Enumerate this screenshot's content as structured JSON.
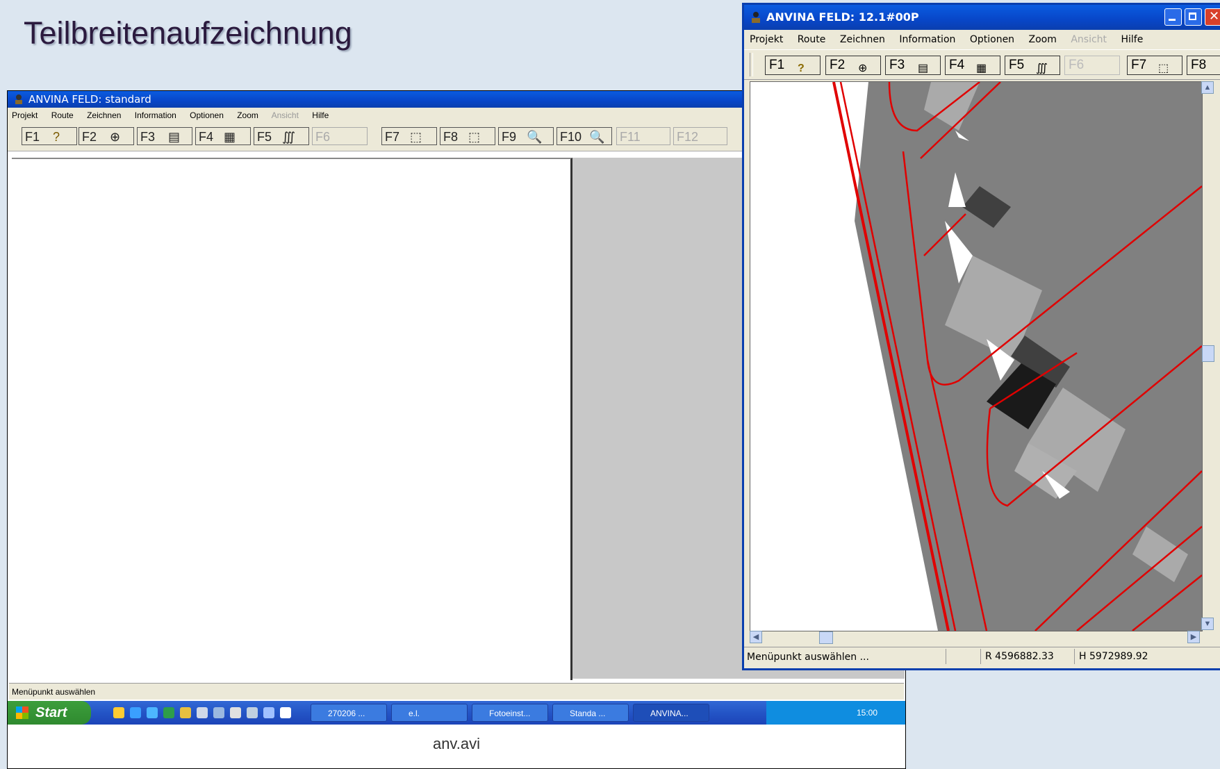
{
  "slide": {
    "title": "Teilbreitenaufzeichnung",
    "caption": "anv.avi"
  },
  "back_window": {
    "title": "ANVINA FELD: standard",
    "menu": [
      "Projekt",
      "Route",
      "Zeichnen",
      "Information",
      "Optionen",
      "Zoom",
      "Ansicht",
      "Hilfe"
    ],
    "toolbar": [
      "F1",
      "F2",
      "F3",
      "F4",
      "F5",
      "F6",
      "F7",
      "F8",
      "F9",
      "F10",
      "F11",
      "F12"
    ],
    "status": "Menüpunkt auswählen",
    "taskbar": {
      "start": "Start",
      "tasks": [
        "270206 ...",
        "e.l.",
        "Fotoeinst...",
        "Standa ...",
        "ANVINA..."
      ],
      "tray_time": "15:00"
    }
  },
  "front_window": {
    "title": "ANVINA  FELD: 12.1#00P",
    "menu": [
      "Projekt",
      "Route",
      "Zeichnen",
      "Information",
      "Optionen",
      "Zoom",
      "Ansicht",
      "Hilfe"
    ],
    "menu_disabled": [
      "Ansicht"
    ],
    "toolbar": [
      "F1",
      "F2",
      "F3",
      "F4",
      "F5",
      "F6",
      "F7",
      "F8"
    ],
    "toolbar_icons": [
      "help-icon",
      "target-icon",
      "list-icon",
      "field-icon",
      "zigzag-icon",
      "",
      "zoom-window-icon",
      ""
    ],
    "status": {
      "message": "Menüpunkt auswählen ...",
      "r": "R 4596882.33",
      "h": "H 5972989.92"
    },
    "colors": {
      "boundary": "#e00000",
      "coverage": "#808080",
      "overlap": "#1a1a1a"
    }
  }
}
